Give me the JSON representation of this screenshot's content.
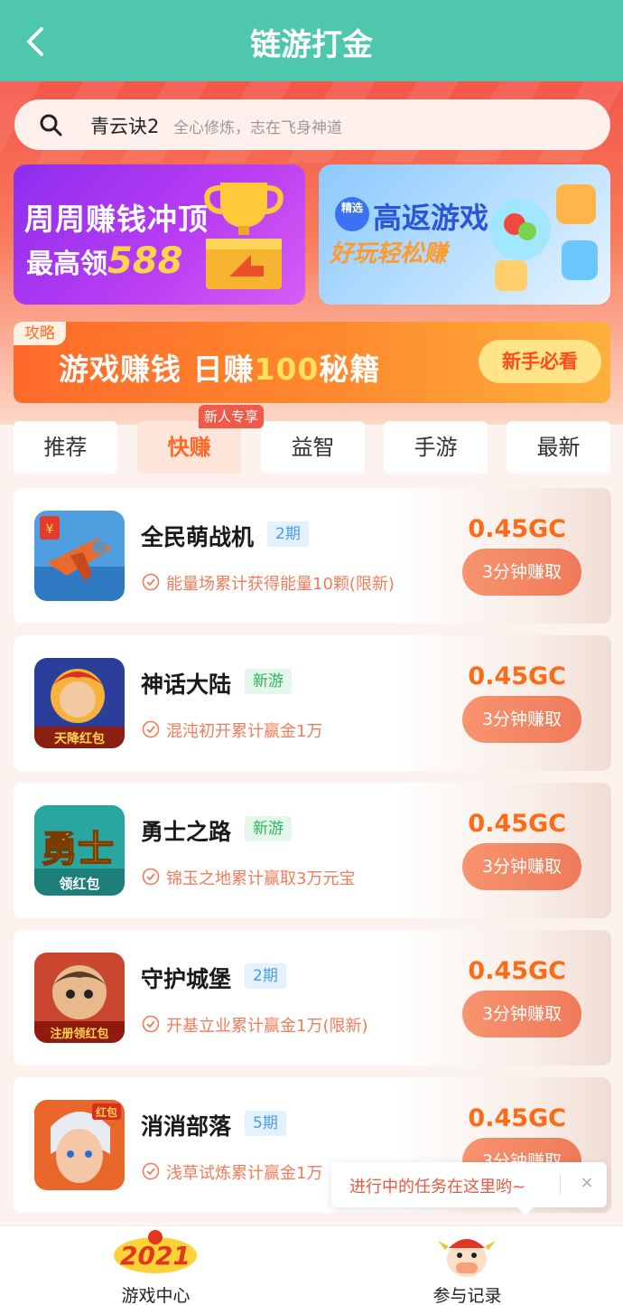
{
  "header": {
    "title": "链游打金"
  },
  "search": {
    "keyword": "青云诀2",
    "hint": "全心修炼，志在飞身神道"
  },
  "banners": {
    "left": {
      "line1": "周周赚钱冲顶",
      "line2_prefix": "最高领",
      "line2_number": "588"
    },
    "right": {
      "badge": "精选",
      "line1": "高返游戏",
      "line2": "好玩轻松赚"
    }
  },
  "promo": {
    "tag": "攻略",
    "text_prefix": "游戏赚钱 日赚",
    "text_number": "100",
    "text_suffix": "秘籍",
    "button": "新手必看"
  },
  "tabs": {
    "badge": "新人专享",
    "items": [
      {
        "label": "推荐"
      },
      {
        "label": "快赚"
      },
      {
        "label": "益智"
      },
      {
        "label": "手游"
      },
      {
        "label": "最新"
      }
    ]
  },
  "games": [
    {
      "name": "全民萌战机",
      "tag": "2期",
      "tag_color": "blue",
      "desc": "能量场累计获得能量10颗(限新)",
      "reward": "0.45GC",
      "button": "3分钟赚取"
    },
    {
      "name": "神话大陆",
      "tag": "新游",
      "tag_color": "green",
      "desc": "混沌初开累计赢金1万",
      "reward": "0.45GC",
      "button": "3分钟赚取"
    },
    {
      "name": "勇士之路",
      "tag": "新游",
      "tag_color": "green",
      "desc": "锦玉之地累计赢取3万元宝",
      "reward": "0.45GC",
      "button": "3分钟赚取"
    },
    {
      "name": "守护城堡",
      "tag": "2期",
      "tag_color": "blue",
      "desc": "开基立业累计赢金1万(限新)",
      "reward": "0.45GC",
      "button": "3分钟赚取"
    },
    {
      "name": "消消部落",
      "tag": "5期",
      "tag_color": "blue",
      "desc": "浅草试炼累计赢金1万",
      "reward": "0.45GC",
      "button": "3分钟赚取"
    }
  ],
  "game_icon_texts": [
    "天降红包",
    "勇士",
    "领红包",
    "注册领红包",
    "红包"
  ],
  "tooltip": {
    "text": "进行中的任务在这里哟~",
    "close": "×"
  },
  "bottom_nav": [
    {
      "label": "游戏中心",
      "icon_text": "2021"
    },
    {
      "label": "参与记录"
    }
  ],
  "colors": {
    "header": "#4fc7ad",
    "accent": "#ff6a16",
    "button": "#ef7a5a"
  }
}
